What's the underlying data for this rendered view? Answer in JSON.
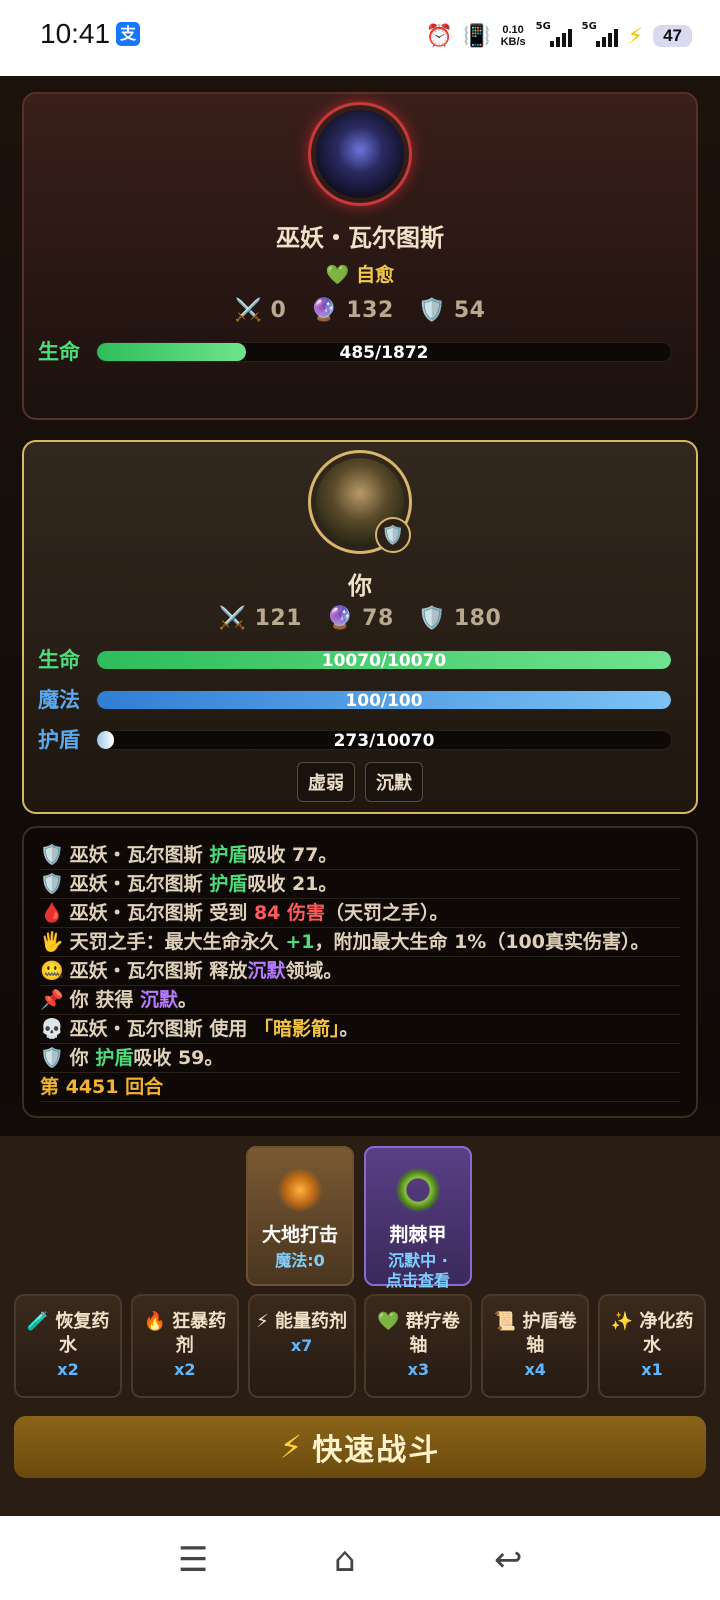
{
  "status_bar": {
    "time": "10:41",
    "speed_top": "0.10",
    "speed_unit": "KB/s",
    "net1": "5G",
    "net2": "5G",
    "battery": "47"
  },
  "enemy": {
    "name": "巫妖・瓦尔图斯",
    "trait_icon": "green-heart-icon",
    "trait": "自愈",
    "attack": "0",
    "magic": "132",
    "defense": "54",
    "hp_label": "生命",
    "hp_text": "485/1872",
    "hp_current": 485,
    "hp_max": 1872
  },
  "player": {
    "name": "你",
    "attack": "121",
    "magic": "78",
    "defense": "180",
    "hp_label": "生命",
    "hp_text": "10070/10070",
    "hp_current": 10070,
    "hp_max": 10070,
    "mp_label": "魔法",
    "mp_text": "100/100",
    "mp_current": 100,
    "mp_max": 100,
    "shield_label": "护盾",
    "shield_text": "273/10070",
    "shield_current": 273,
    "shield_max": 10070,
    "statuses": [
      "虚弱",
      "沉默"
    ]
  },
  "log": {
    "line1": {
      "actor": "巫妖・瓦尔图斯",
      "key": "护盾",
      "rest": "吸收 77。"
    },
    "line2": {
      "actor": "巫妖・瓦尔图斯",
      "key": "护盾",
      "rest": "吸收 21。"
    },
    "line3": {
      "actor": "巫妖・瓦尔图斯",
      "mid": "受到",
      "dmg": "84 伤害",
      "rest": "（天罚之手）。"
    },
    "line4": {
      "pre": "天罚之手：最大生命永久",
      "plus": "+1",
      "rest": "，附加最大生命 1%（100真实伤害）。"
    },
    "line5": {
      "actor": "巫妖・瓦尔图斯",
      "mid": "释放",
      "key": "沉默",
      "rest": "领域。"
    },
    "line6": {
      "actor": "你",
      "mid": "获得",
      "key": "沉默",
      "rest": "。"
    },
    "line7": {
      "actor": "巫妖・瓦尔图斯",
      "mid": "使用",
      "key": "「暗影箭」",
      "rest": "。"
    },
    "line8": {
      "actor": "你",
      "key": "护盾",
      "rest": "吸收 59。"
    },
    "round": "第 4451 回合"
  },
  "skills": [
    {
      "name": "大地打击",
      "sub": "魔法:0"
    },
    {
      "name": "荆棘甲",
      "sub1": "沉默中 ·",
      "sub2": "点击查看"
    }
  ],
  "items": [
    {
      "icon": "🧪",
      "name": "恢复药水",
      "count": "x2"
    },
    {
      "icon": "🔥",
      "name": "狂暴药剂",
      "count": "x2"
    },
    {
      "icon": "⚡",
      "name": "能量药剂",
      "count": "x7"
    },
    {
      "icon": "💚",
      "name": "群疗卷轴",
      "count": "x3"
    },
    {
      "icon": "📜",
      "name": "护盾卷轴",
      "count": "x4"
    },
    {
      "icon": "✨",
      "name": "净化药水",
      "count": "x1"
    }
  ],
  "quick_battle": {
    "icon": "⚡",
    "label": "快速战斗"
  },
  "icons": {
    "attack": "⚔️",
    "magic": "🔮",
    "defense": "🛡️"
  }
}
